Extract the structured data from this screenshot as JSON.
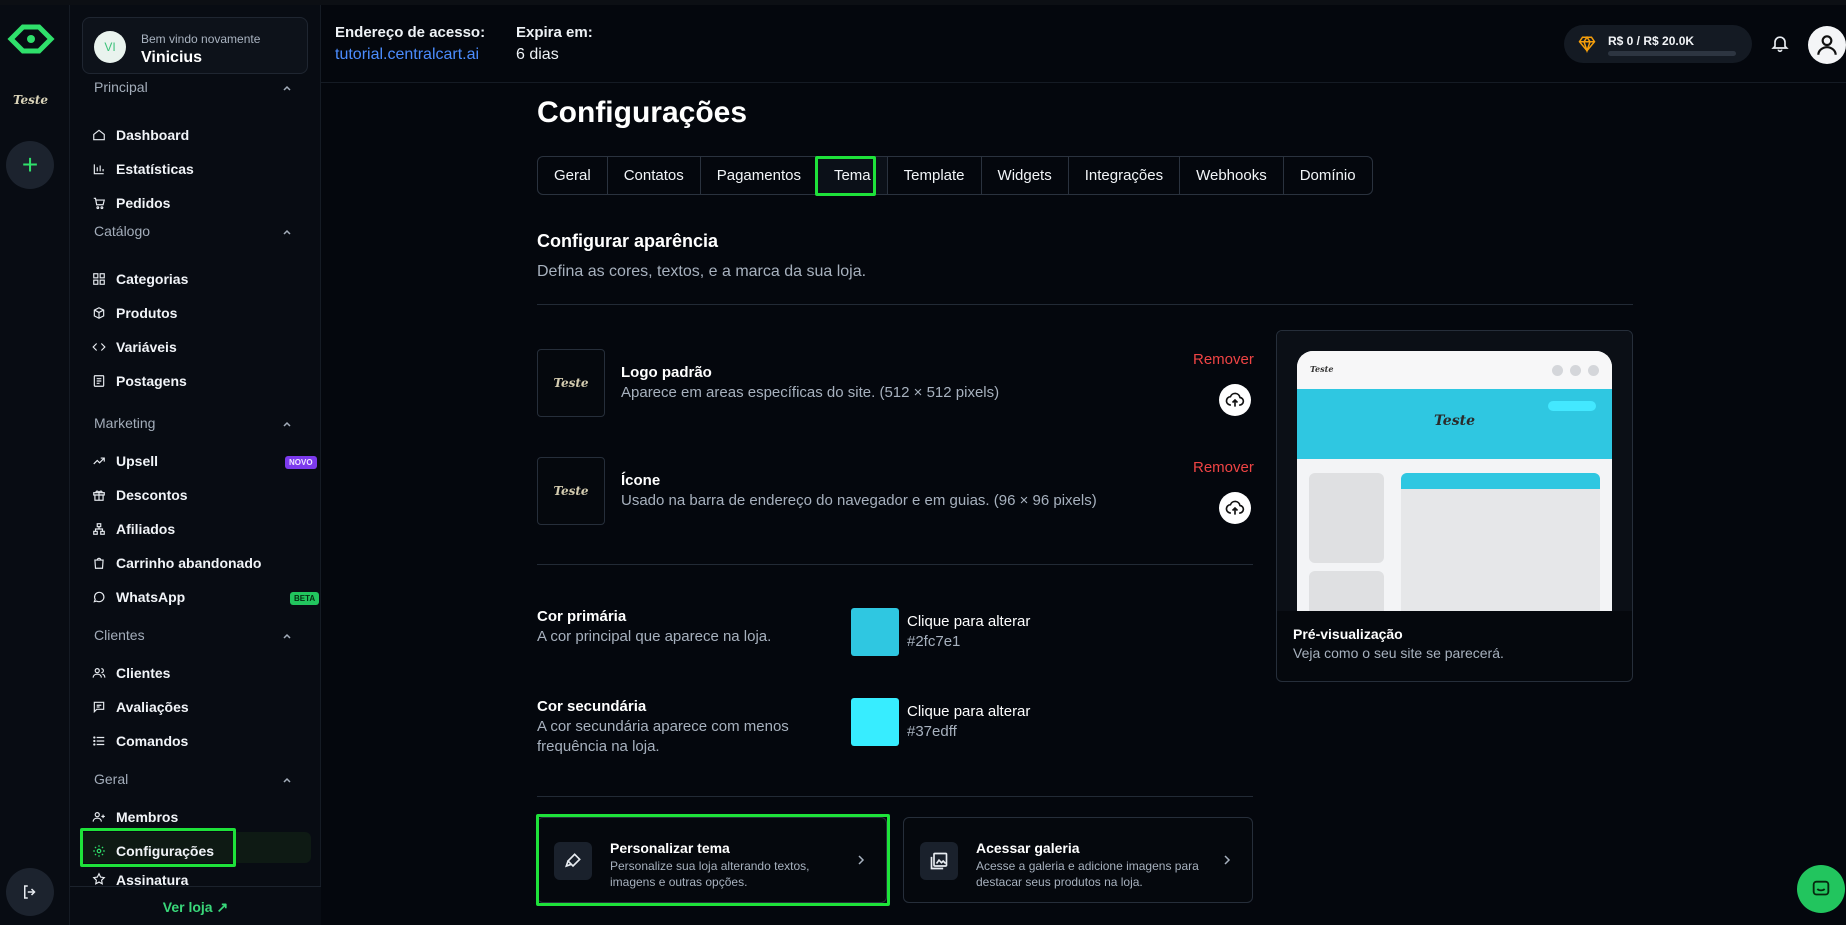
{
  "rail": {
    "store_name": "Teste",
    "add_symbol": "+"
  },
  "user": {
    "initials": "VI",
    "welcome": "Bem vindo novamente",
    "name": "Vinicius"
  },
  "sidebar": {
    "sections": [
      {
        "label": "Principal",
        "items": [
          "Dashboard",
          "Estatísticas",
          "Pedidos"
        ]
      },
      {
        "label": "Catálogo",
        "items": [
          "Categorias",
          "Produtos",
          "Variáveis",
          "Postagens"
        ]
      },
      {
        "label": "Marketing",
        "items": [
          "Upsell",
          "Descontos",
          "Afiliados",
          "Carrinho abandonado",
          "WhatsApp"
        ]
      },
      {
        "label": "Clientes",
        "items": [
          "Clientes",
          "Avaliações",
          "Comandos"
        ]
      },
      {
        "label": "Geral",
        "items": [
          "Membros",
          "Configurações",
          "Assinatura"
        ]
      }
    ],
    "badges": {
      "novo": "NOVO",
      "beta": "BETA"
    },
    "footer_link": "Ver loja ↗"
  },
  "header": {
    "address_label": "Endereço de acesso:",
    "address_value": "tutorial.centralcart.ai",
    "expires_label": "Expira em:",
    "expires_value": "6 dias",
    "plan_text": "R$ 0 / R$ 20.0K",
    "plan_progress": 0
  },
  "page": {
    "title": "Configurações",
    "tabs": [
      "Geral",
      "Contatos",
      "Pagamentos",
      "Tema",
      "Template",
      "Widgets",
      "Integrações",
      "Webhooks",
      "Domínio"
    ],
    "active_tab": "Tema",
    "section_title": "Configurar aparência",
    "section_subtitle": "Defina as cores, textos, e a marca da sua loja."
  },
  "assets": {
    "logo": {
      "preview_text": "Teste",
      "title": "Logo padrão",
      "description": "Aparece em areas específicas do site. (512 × 512 pixels)",
      "remove": "Remover"
    },
    "icon": {
      "preview_text": "Teste",
      "title": "Ícone",
      "description": "Usado na barra de endereço do navegador e em guias. (96 × 96 pixels)",
      "remove": "Remover"
    }
  },
  "colors": {
    "primary": {
      "label": "Cor primária",
      "description": "A cor principal que aparece na loja.",
      "action": "Clique para alterar",
      "hex": "#2fc7e1"
    },
    "secondary": {
      "label": "Cor secundária",
      "description": "A cor secundária aparece com menos frequência na loja.",
      "action": "Clique para alterar",
      "hex": "#37edff"
    }
  },
  "cards": {
    "customize": {
      "title": "Personalizar tema",
      "description": "Personalize sua loja alterando textos, imagens e outras opções."
    },
    "gallery": {
      "title": "Acessar galeria",
      "description": "Acesse a galeria e adicione imagens para destacar seus produtos na loja."
    }
  },
  "preview": {
    "logo_text": "Teste",
    "title": "Pré-visualização",
    "subtitle": "Veja como o seu site se parecerá."
  }
}
